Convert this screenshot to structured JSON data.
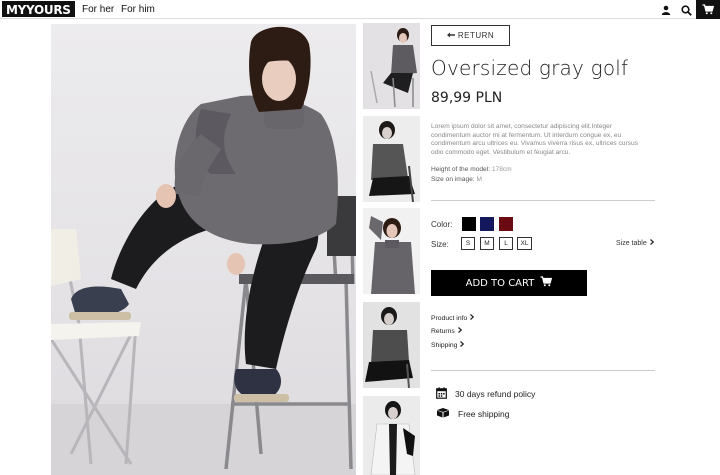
{
  "header": {
    "logo": "MYYOURS",
    "nav": [
      {
        "label": "For her"
      },
      {
        "label": "For him"
      }
    ],
    "icons": [
      "user-icon",
      "search-icon",
      "cart-icon"
    ]
  },
  "product": {
    "return_label": "RETURN",
    "title": "Oversized gray golf",
    "price": "89,99 PLN",
    "description": "Lorem ipsum dolor sit amet, consectetur adipiscing elit.Integer condimentum auctor mi at fermentum. Ut interdum congue ex, eu condimentum arcu ultrices eu. Vivamus viverra risus ex, ultrices cursus odio commodo eget. Vestibulum et feugiat arcu.",
    "height_label": "Height of the model:",
    "height_value": "178cm",
    "size_on_image_label": "Size on image:",
    "size_on_image_value": "M",
    "color_label": "Color:",
    "colors": [
      "#000000",
      "#14195e",
      "#6b0a10"
    ],
    "size_label": "Size:",
    "sizes": [
      "S",
      "M",
      "L",
      "XL"
    ],
    "size_table_label": "Size table",
    "add_to_cart_label": "ADD TO CART",
    "links": [
      {
        "label": "Product info"
      },
      {
        "label": "Returns"
      },
      {
        "label": "Shipping"
      }
    ],
    "features": [
      {
        "label": "30 days refund policy",
        "icon": "calendar-icon"
      },
      {
        "label": "Free shipping",
        "icon": "box-icon"
      }
    ]
  },
  "gallery": {
    "main_image": "model-seated-photo",
    "thumbnails": [
      "thumb-1",
      "thumb-2",
      "thumb-3",
      "thumb-4",
      "thumb-5"
    ]
  }
}
